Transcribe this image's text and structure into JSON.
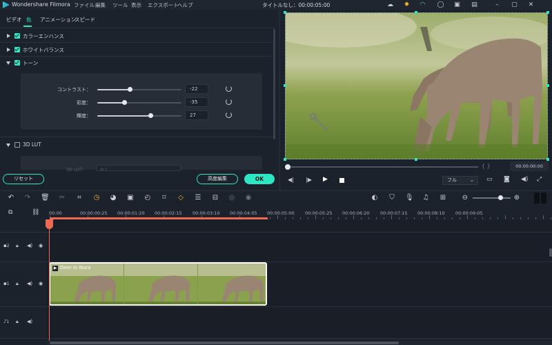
{
  "titlebar": {
    "app_name": "Wondershare Filmora",
    "menu": [
      "ファイル",
      "編集",
      "ツール",
      "表示",
      "エクスポート",
      "ヘルプ"
    ],
    "document_title": "タイトルなし：00:00:05:00"
  },
  "tabs": [
    "ビデオ",
    "色",
    "アニメーション",
    "スピード"
  ],
  "sections": {
    "color_enhance": "カラーエンハンス",
    "white_balance": "ホワイトバランス",
    "tone": "トーン",
    "lut": "3D LUT",
    "lut_row_label": "3D LUT：",
    "lut_value": "なし"
  },
  "sliders": [
    {
      "label": "コントラスト：",
      "value": "-22",
      "level": 0.42
    },
    {
      "label": "彩度：",
      "value": "-35",
      "level": 0.33
    },
    {
      "label": "輝度：",
      "value": "27",
      "level": 0.63
    }
  ],
  "buttons": {
    "reset": "リセット",
    "advanced": "高度編集",
    "ok": "OK"
  },
  "preview": {
    "timecode": "00:00:00:00",
    "quality": "フル",
    "brackets": "{      }"
  },
  "ruler": [
    "00:00",
    "00:00:00:25",
    "00:00:01:20",
    "00:00:02:15",
    "00:00:03:10",
    "00:00:04:05",
    "00:00:05:00",
    "00:00:05:25",
    "00:00:06:20",
    "00:00:07:15",
    "00:00:08:10",
    "00:00:09:05"
  ],
  "tracks": [
    {
      "id": "2",
      "type": "video"
    },
    {
      "id": "1",
      "type": "video"
    },
    {
      "id": "1",
      "type": "audio"
    }
  ],
  "clip": {
    "name": "Deer in Nara"
  },
  "colors": {
    "accent": "#2ee6c3",
    "playhead": "#ef6a55",
    "background": "#1c222b"
  }
}
